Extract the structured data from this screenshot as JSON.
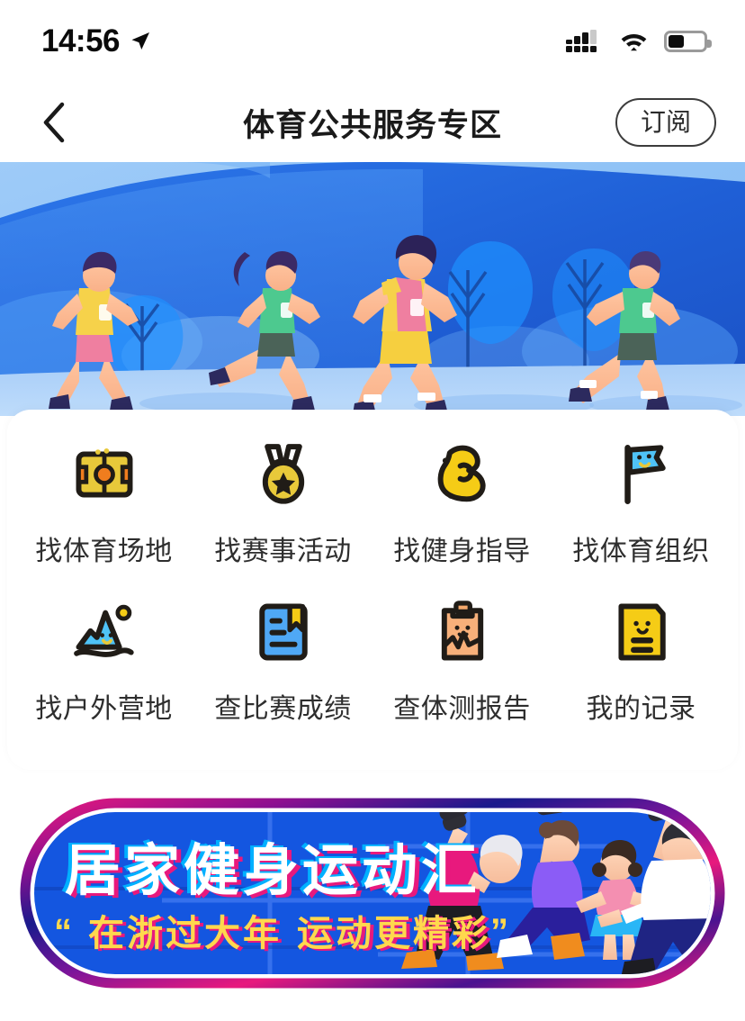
{
  "status_bar": {
    "time": "14:56",
    "location_icon": "location-arrow-icon",
    "signal_icon": "cellular-signal-icon",
    "wifi_icon": "wifi-icon",
    "battery_icon": "battery-icon",
    "battery_level_pct": 45
  },
  "nav": {
    "back_icon": "chevron-left-icon",
    "title": "体育公共服务专区",
    "subscribe_label": "订阅"
  },
  "hero": {
    "alt": "four-runners-illustration",
    "colors": {
      "sky": "#8ec3f5",
      "mid_blue": "#3d8bf2",
      "deep_blue": "#1f63d8",
      "ground": "#a7cbf7"
    }
  },
  "grid": {
    "items": [
      {
        "icon": "sports-field-icon",
        "label": "找体育场地"
      },
      {
        "icon": "medal-icon",
        "label": "找赛事活动"
      },
      {
        "icon": "flexed-bicep-icon",
        "label": "找健身指导"
      },
      {
        "icon": "flag-icon",
        "label": "找体育组织"
      },
      {
        "icon": "mountain-icon",
        "label": "找户外营地"
      },
      {
        "icon": "bookmark-doc-icon",
        "label": "查比赛成绩"
      },
      {
        "icon": "clipboard-chart-icon",
        "label": "查体测报告"
      },
      {
        "icon": "record-card-icon",
        "label": "我的记录"
      }
    ]
  },
  "promo": {
    "title": "居家健身运动汇",
    "subtitle_open_quote": "“",
    "subtitle_left": "在浙过大年",
    "subtitle_right": "运动更精彩",
    "subtitle_close_quote": "”",
    "alt": "family-exercising-with-dumbbells",
    "colors": {
      "ring_pink": "#e8197d",
      "ring_navy": "#1a1a8c",
      "fill_blue": "#1456e0",
      "subtitle_yellow": "#ffd84d"
    }
  }
}
